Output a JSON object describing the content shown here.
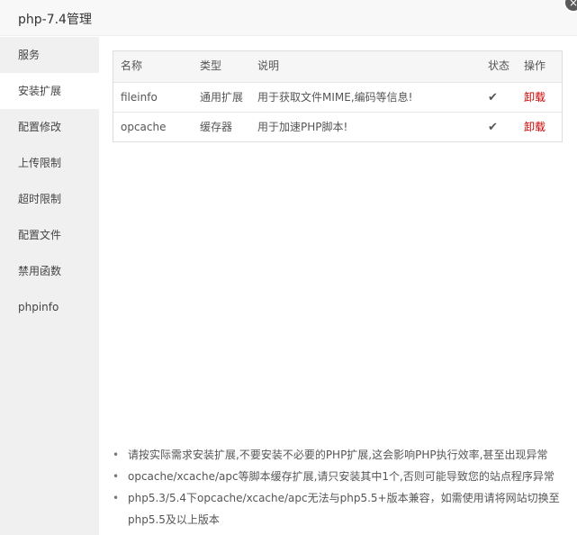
{
  "window": {
    "title": "php-7.4管理",
    "close_icon": "×"
  },
  "sidebar": {
    "items": [
      {
        "label": "服务"
      },
      {
        "label": "安装扩展"
      },
      {
        "label": "配置修改"
      },
      {
        "label": "上传限制"
      },
      {
        "label": "超时限制"
      },
      {
        "label": "配置文件"
      },
      {
        "label": "禁用函数"
      },
      {
        "label": "phpinfo"
      }
    ],
    "active": "安装扩展"
  },
  "table": {
    "headers": [
      "名称",
      "类型",
      "说明",
      "状态",
      "操作"
    ],
    "rows": [
      {
        "name": "fileinfo",
        "type": "通用扩展",
        "desc": "用于获取文件MIME,编码等信息!",
        "status_icon": "✔",
        "action": "卸载"
      },
      {
        "name": "opcache",
        "type": "缓存器",
        "desc": "用于加速PHP脚本!",
        "status_icon": "✔",
        "action": "卸载"
      }
    ]
  },
  "tips": [
    "请按实际需求安装扩展,不要安装不必要的PHP扩展,这会影响PHP执行效率,甚至出现异常",
    "opcache/xcache/apc等脚本缓存扩展,请只安装其中1个,否则可能导致您的站点程序异常",
    "php5.3/5.4下opcache/xcache/apc无法与php5.5+版本兼容，如需使用请将网站切换至php5.5及以上版本"
  ],
  "colors": {
    "accent_danger": "#cc0000",
    "sidebar_bg": "#f0f0f0"
  }
}
